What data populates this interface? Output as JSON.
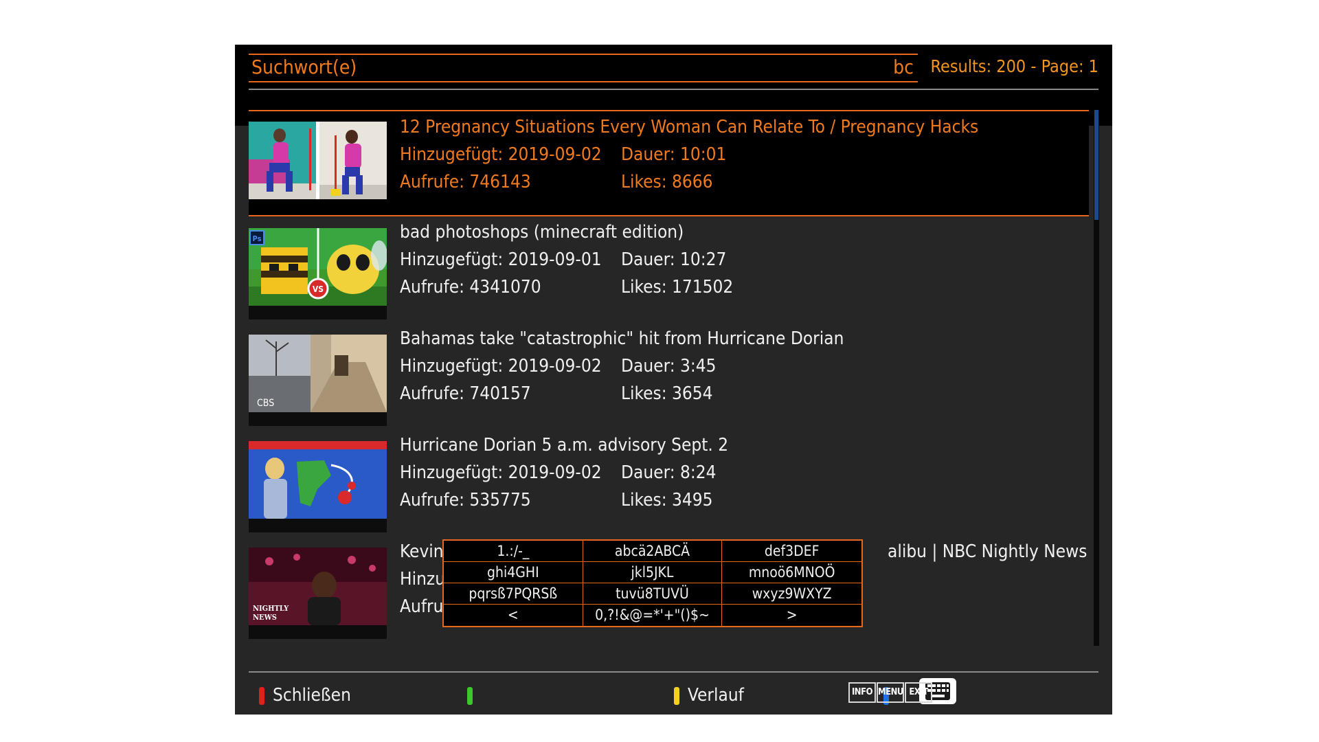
{
  "search": {
    "label": "Suchwort(e)",
    "value": "bc",
    "results": "Results: 200 - Page: 1"
  },
  "videos": [
    {
      "title": "12 Pregnancy Situations Every Woman Can Relate To / Pregnancy Hacks",
      "added": "Hinzugefügt: 2019-09-02",
      "duration": "Dauer: 10:01",
      "views": "Aufrufe: 746143",
      "likes": "Likes: 8666",
      "selected": true
    },
    {
      "title": "bad photoshops (minecraft edition)",
      "added": "Hinzugefügt: 2019-09-01",
      "duration": "Dauer: 10:27",
      "views": "Aufrufe: 4341070",
      "likes": "Likes: 171502"
    },
    {
      "title": "Bahamas take \"catastrophic\" hit from Hurricane Dorian",
      "added": "Hinzugefügt: 2019-09-02",
      "duration": "Dauer: 3:45",
      "views": "Aufrufe: 740157",
      "likes": "Likes: 3654"
    },
    {
      "title": "Hurricane Dorian 5 a.m. advisory Sept. 2",
      "added": "Hinzugefügt: 2019-09-02",
      "duration": "Dauer: 8:24",
      "views": "Aufrufe: 535775",
      "likes": "Likes: 3495"
    },
    {
      "title_left": "Kevin",
      "title_right": "alibu | NBC Nightly News",
      "added_partial": "Hinzu",
      "views_partial": "Aufru"
    }
  ],
  "thumbnail_text": {
    "ps_badge": "Ps",
    "vs_badge": "VS",
    "cbs_logo": "CBS",
    "nbc_logo_1": "NIGHTLY",
    "nbc_logo_2": "NEWS"
  },
  "keyboard": {
    "keys": [
      "1.:/-_",
      "abcä2ABCÄ",
      "def3DEF",
      "ghi4GHI",
      "jkl5JKL",
      "mnoö6MNOÖ",
      "pqrsß7PQRSß",
      "tuvü8TUVÜ",
      "wxyz9WXYZ",
      "<",
      "0,?!&@=*'+\"()$~",
      ">"
    ]
  },
  "footer": {
    "red_label": "Schließen",
    "yellow_label": "Verlauf",
    "info": "INFO",
    "menu": "MENU",
    "exit": "EXIT"
  },
  "colors": {
    "accent": "#e8671a",
    "red": "#e0201a",
    "green": "#3cc82a",
    "yellow": "#f2d21e",
    "blue": "#1e6ee8"
  },
  "icons": [
    "keyboard-icon"
  ]
}
